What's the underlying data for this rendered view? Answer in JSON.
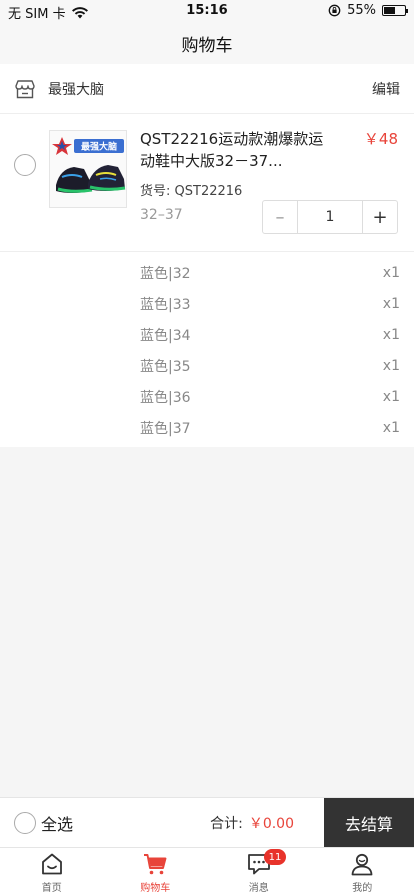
{
  "status_bar": {
    "carrier": "无 SIM 卡",
    "time": "15:16",
    "battery_percent": "55%",
    "battery_level": 0.55
  },
  "nav": {
    "title": "购物车"
  },
  "store": {
    "name": "最强大脑",
    "edit_label": "编辑",
    "icon": "store-icon"
  },
  "product": {
    "title": "QST22216运动款潮爆款运动鞋中大版32－37...",
    "price": "￥48",
    "sku": "货号: QST22216",
    "size_range": "32–37",
    "quantity": "1",
    "minus_label": "–",
    "plus_label": "+",
    "thumb_text": "最强大脑"
  },
  "variants": [
    {
      "name": "蓝色|32",
      "qty": "x1"
    },
    {
      "name": "蓝色|33",
      "qty": "x1"
    },
    {
      "name": "蓝色|34",
      "qty": "x1"
    },
    {
      "name": "蓝色|35",
      "qty": "x1"
    },
    {
      "name": "蓝色|36",
      "qty": "x1"
    },
    {
      "name": "蓝色|37",
      "qty": "x1"
    }
  ],
  "checkout": {
    "select_all_label": "全选",
    "total_label": "合计:",
    "total_value": "￥0.00",
    "checkout_label": "去结算"
  },
  "tabs": [
    {
      "label": "首页",
      "icon": "home-icon"
    },
    {
      "label": "购物车",
      "icon": "cart-icon"
    },
    {
      "label": "消息",
      "icon": "message-icon",
      "badge": "11"
    },
    {
      "label": "我的",
      "icon": "profile-icon"
    }
  ],
  "colors": {
    "accent": "#e8443a",
    "checkout_bg": "#333333"
  }
}
